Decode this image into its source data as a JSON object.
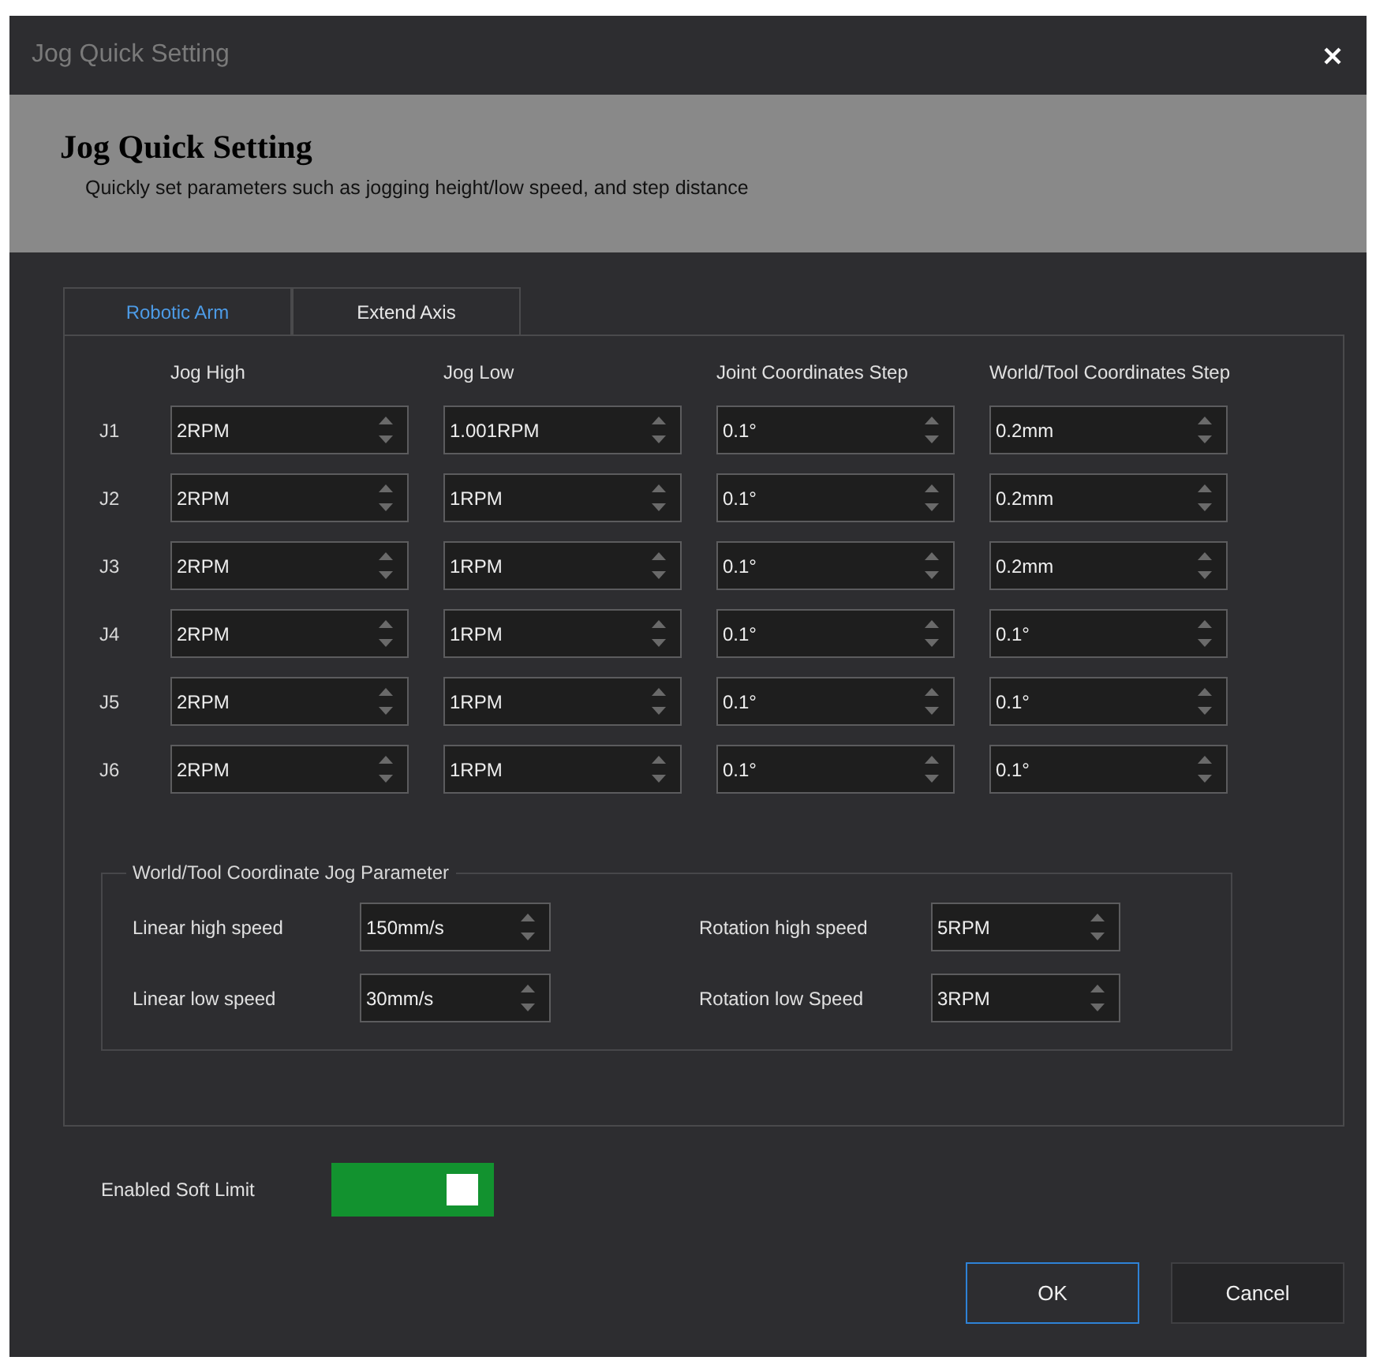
{
  "window": {
    "title": "Jog Quick Setting"
  },
  "header": {
    "title": "Jog Quick Setting",
    "subtitle": "Quickly set parameters such as jogging height/low speed, and step distance"
  },
  "tabs": [
    {
      "label": "Robotic Arm",
      "selected": true
    },
    {
      "label": "Extend Axis",
      "selected": false
    }
  ],
  "table": {
    "columns": [
      "Jog High",
      "Jog Low",
      "Joint Coordinates Step",
      "World/Tool Coordinates Step"
    ],
    "rows": [
      {
        "label": "J1",
        "values": [
          "2RPM",
          "1.001RPM",
          "0.1°",
          "0.2mm"
        ]
      },
      {
        "label": "J2",
        "values": [
          "2RPM",
          "1RPM",
          "0.1°",
          "0.2mm"
        ]
      },
      {
        "label": "J3",
        "values": [
          "2RPM",
          "1RPM",
          "0.1°",
          "0.2mm"
        ]
      },
      {
        "label": "J4",
        "values": [
          "2RPM",
          "1RPM",
          "0.1°",
          "0.1°"
        ]
      },
      {
        "label": "J5",
        "values": [
          "2RPM",
          "1RPM",
          "0.1°",
          "0.1°"
        ]
      },
      {
        "label": "J6",
        "values": [
          "2RPM",
          "1RPM",
          "0.1°",
          "0.1°"
        ]
      }
    ]
  },
  "group": {
    "title": "World/Tool Coordinate Jog Parameter",
    "fields": [
      {
        "label": "Linear high speed",
        "value": "150mm/s"
      },
      {
        "label": "Rotation high speed",
        "value": "5RPM"
      },
      {
        "label": "Linear low speed",
        "value": "30mm/s"
      },
      {
        "label": "Rotation low Speed",
        "value": "3RPM"
      }
    ]
  },
  "soft_limit": {
    "label": "Enabled Soft Limit",
    "on": true
  },
  "buttons": [
    {
      "label": "OK",
      "focused": true
    },
    {
      "label": "Cancel",
      "focused": false
    }
  ]
}
